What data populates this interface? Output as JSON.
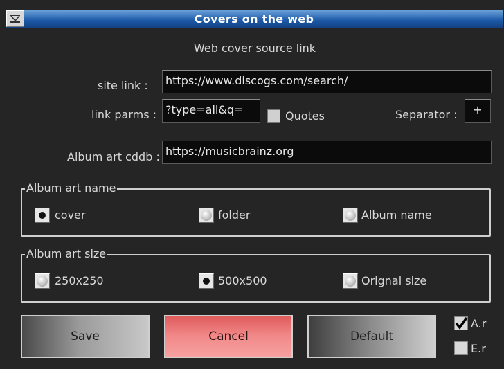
{
  "window": {
    "title": "Covers on the web"
  },
  "header": {
    "subtitle": "Web cover source link"
  },
  "fields": {
    "site_link_label": "site link :",
    "site_link_value": "https://www.discogs.com/search/",
    "link_parms_label": "link parms :",
    "link_parms_value": "?type=all&q=",
    "quotes_label": "Quotes",
    "separator_label": "Separator :",
    "separator_value": "+",
    "cddb_label": "Album art cddb :",
    "cddb_value": "https://musicbrainz.org"
  },
  "album_art_name": {
    "legend": "Album art name",
    "options": [
      "cover",
      "folder",
      "Album name"
    ],
    "selected": "cover"
  },
  "album_art_size": {
    "legend": "Album art size",
    "options": [
      "250x250",
      "500x500",
      "Orignal size"
    ],
    "selected": "500x500"
  },
  "buttons": {
    "save": "Save",
    "cancel": "Cancel",
    "default": "Default"
  },
  "toggles": {
    "ar_label": "A.r",
    "ar_checked": true,
    "er_label": "E.r",
    "er_checked": false
  },
  "colors": {
    "titlebar": "#1d5aa8",
    "background": "#252525",
    "cancel": "#f28a8a"
  }
}
